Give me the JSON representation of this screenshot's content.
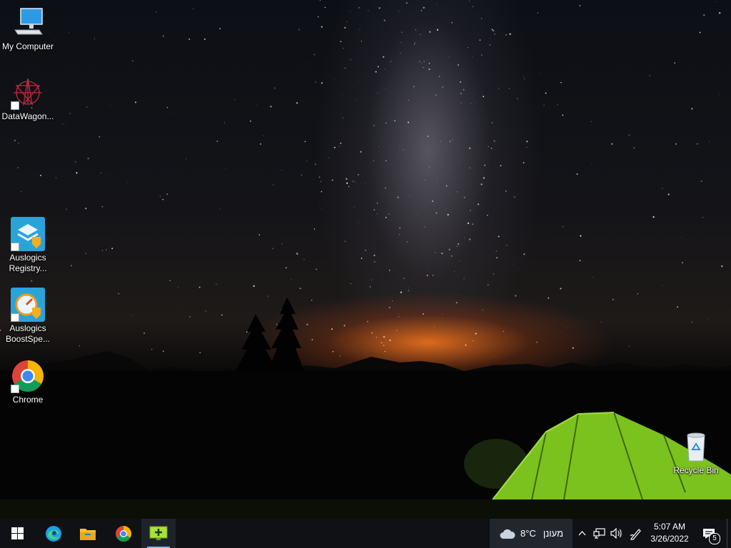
{
  "desktop": {
    "icons": [
      {
        "label": "My Computer",
        "icon": "computer-icon",
        "shortcut": false
      },
      {
        "label": "DataWagon...",
        "icon": "datawagon-icon",
        "shortcut": true
      },
      {
        "label": "Auslogics Registry...",
        "icon": "auslogics-registry-icon",
        "shortcut": true
      },
      {
        "label": "Auslogics BoostSpe...",
        "icon": "auslogics-boostspeed-icon",
        "shortcut": true
      },
      {
        "label": "Chrome",
        "icon": "chrome-icon",
        "shortcut": true
      },
      {
        "label": "Recycle Bin",
        "icon": "recycle-bin-icon",
        "shortcut": false
      }
    ]
  },
  "taskbar": {
    "start": {
      "icon": "windows-logo-icon"
    },
    "pinned": [
      {
        "name": "Microsoft Edge",
        "icon": "edge-icon"
      },
      {
        "name": "File Explorer",
        "icon": "folder-icon"
      },
      {
        "name": "Google Chrome",
        "icon": "chrome-icon"
      },
      {
        "name": "Remote Desktop",
        "icon": "remote-desktop-icon",
        "active": true
      }
    ],
    "weather": {
      "temperature": "8°C",
      "condition": "מעונן",
      "icon": "cloud-icon"
    },
    "tray": {
      "icons": [
        "chevron-up-icon",
        "network-icon",
        "volume-icon",
        "pen-icon"
      ],
      "time": "5:07 AM",
      "date": "3/26/2022",
      "notification_count": "5"
    }
  },
  "colors": {
    "taskbar_bg": "#0f1115",
    "weather_bg": "#22262d",
    "tent_green": "#8fd12a",
    "sunset_glow": "#ff7a1e"
  }
}
